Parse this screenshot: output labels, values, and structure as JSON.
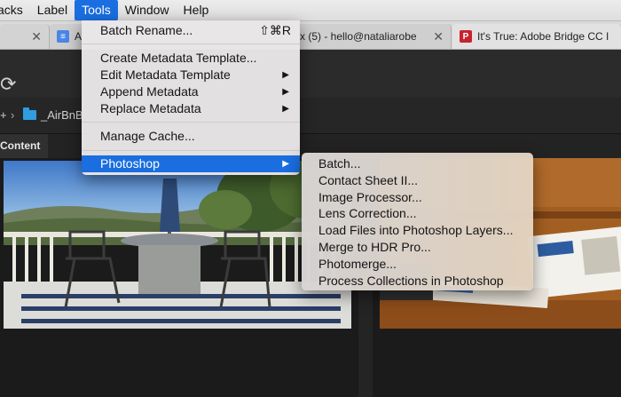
{
  "menubar": {
    "items": [
      "acks",
      "Label",
      "Tools",
      "Window",
      "Help"
    ],
    "active": "Tools"
  },
  "tabs": [
    {
      "title": "A",
      "icon": "favicon-orange-icon"
    },
    {
      "title": "",
      "icon": "google-docs-icon"
    },
    {
      "title": "x (5) - hello@nataliarobe",
      "icon": "gmail-icon"
    },
    {
      "title": "It's True: Adobe Bridge CC I",
      "icon": "pinterest-icon"
    }
  ],
  "toolbar": {
    "refresh_glyph": "⟳"
  },
  "path": {
    "plus": "+",
    "chevron": "›",
    "folder": "_AirBnB"
  },
  "content_panel": {
    "tab_label": "Content"
  },
  "tools_menu": {
    "batch_rename": {
      "label": "Batch Rename...",
      "shortcut": "⇧⌘R"
    },
    "create_metadata_template": "Create Metadata Template...",
    "edit_metadata_template": "Edit Metadata Template",
    "append_metadata": "Append Metadata",
    "replace_metadata": "Replace Metadata",
    "manage_cache": "Manage Cache...",
    "photoshop": "Photoshop",
    "arrow": "▶"
  },
  "photoshop_submenu": [
    "Batch...",
    "Contact Sheet II...",
    "Image Processor...",
    "Lens Correction...",
    "Load Files into Photoshop Layers...",
    "Merge to HDR Pro...",
    "Photomerge...",
    "Process Collections in Photoshop"
  ],
  "colors": {
    "highlight": "#1a6ee0",
    "folder": "#2f9de0"
  }
}
